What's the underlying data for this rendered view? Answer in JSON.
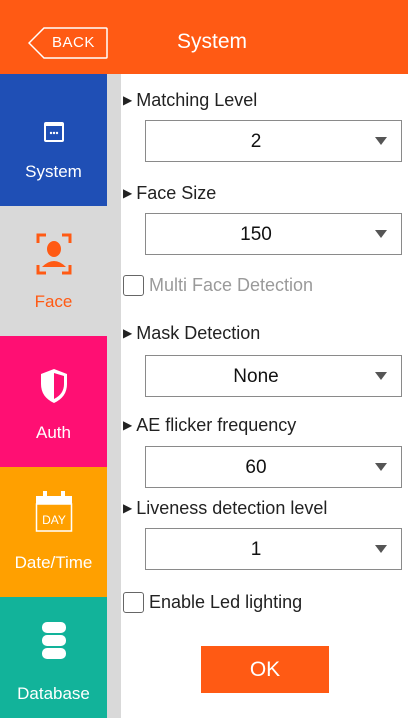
{
  "header": {
    "back_label": "BACK",
    "title": "System",
    "color": "#ff5a14"
  },
  "sidebar": {
    "items": [
      {
        "label": "System",
        "icon": "window-icon",
        "color": "#1f4fb5",
        "active": false
      },
      {
        "label": "Face",
        "icon": "face-scan-icon",
        "color": "#d9d9d9",
        "active": true
      },
      {
        "label": "Auth",
        "icon": "shield-icon",
        "color": "#ff0f73",
        "active": false
      },
      {
        "label": "Date/Time",
        "icon": "calendar-icon",
        "color": "#ffa000",
        "active": false
      },
      {
        "label": "Database",
        "icon": "database-icon",
        "color": "#12b39a",
        "active": false
      }
    ]
  },
  "settings": {
    "matching_level": {
      "label": "Matching Level",
      "value": "2"
    },
    "face_size": {
      "label": "Face Size",
      "value": "150"
    },
    "multi_face": {
      "label": "Multi Face Detection",
      "checked": false,
      "enabled": false
    },
    "mask_detection": {
      "label": "Mask Detection",
      "value": "None"
    },
    "ae_flicker": {
      "label": "AE flicker frequency",
      "value": "60"
    },
    "liveness": {
      "label": "Liveness detection level",
      "value": "1"
    },
    "led_lighting": {
      "label": "Enable Led lighting",
      "checked": false,
      "enabled": true
    }
  },
  "footer": {
    "ok_label": "OK"
  },
  "icons": {
    "calendar_day_text": "DAY"
  }
}
